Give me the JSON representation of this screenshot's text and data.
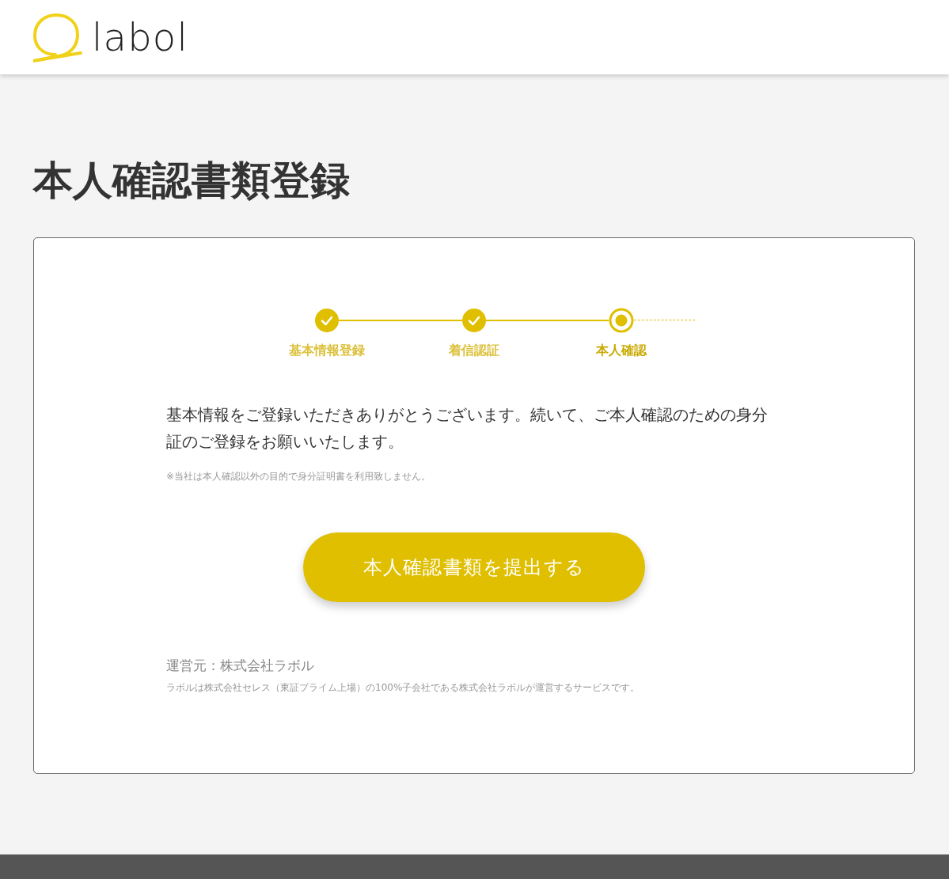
{
  "header": {
    "logo_text": "labol"
  },
  "page_title": "本人確認書類登録",
  "steps": [
    {
      "label": "基本情報登録",
      "completed": true,
      "current": false
    },
    {
      "label": "着信認証",
      "completed": true,
      "current": false
    },
    {
      "label": "本人確認",
      "completed": false,
      "current": true
    }
  ],
  "message": "基本情報をご登録いただきありがとうございます。続いて、ご本人確認のための身分証のご登録をお願いいたします。",
  "note": "※当社は本人確認以外の目的で身分証明書を利用致しません。",
  "submit_button": "本人確認書類を提出する",
  "operator": "運営元：株式会社ラボル",
  "operator_note": "ラボルは株式会社セレス（東証プライム上場）の100%子会社である株式会社ラボルが運営するサービスです。"
}
